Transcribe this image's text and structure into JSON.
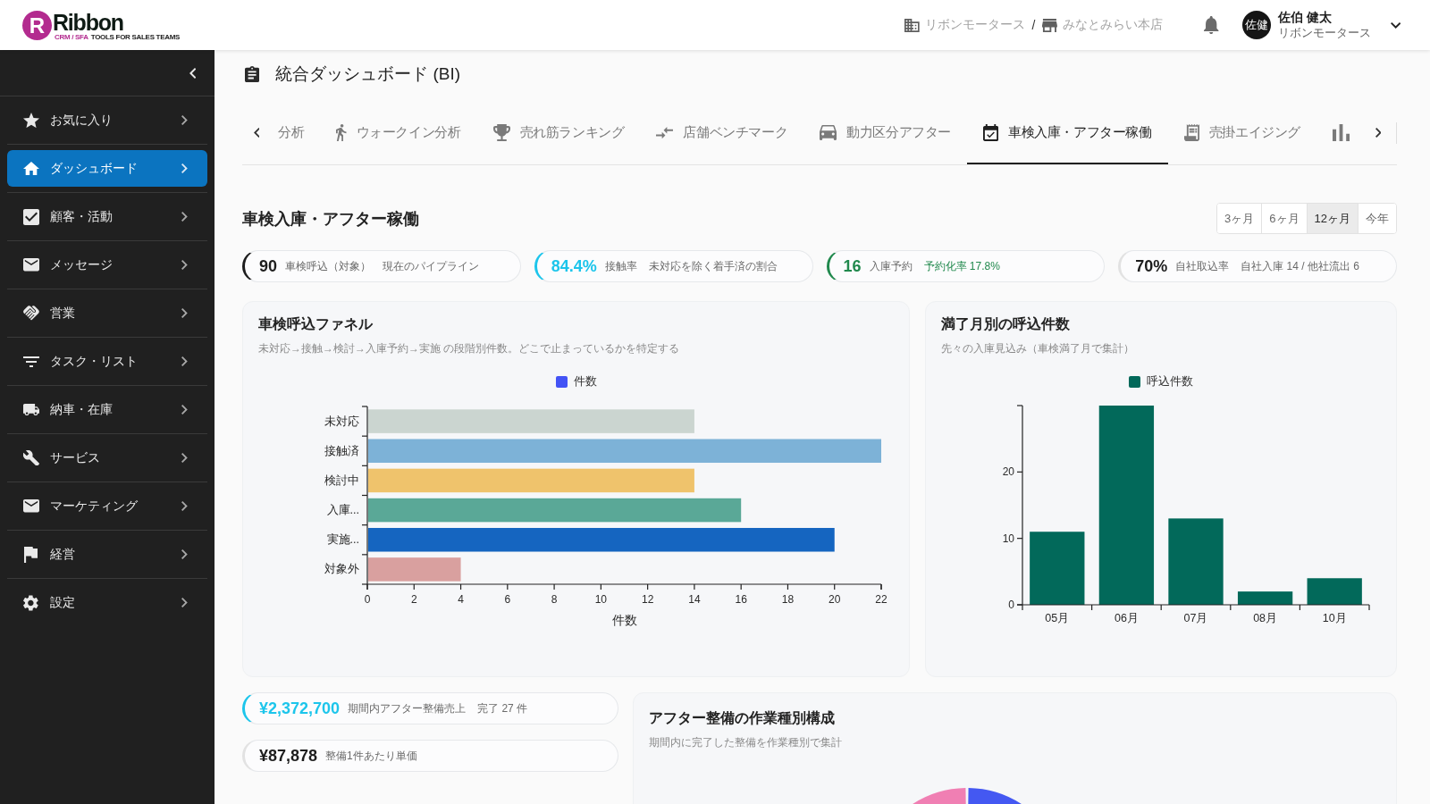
{
  "header": {
    "logo": {
      "mark": "R",
      "name": "Ribbon",
      "tagline_accent": "CRM / SFA",
      "tagline": "TOOLS FOR SALES TEAMS"
    },
    "breadcrumb": [
      {
        "label": "リボンモータース"
      },
      {
        "label": "みなとみらい本店"
      }
    ],
    "breadcrumb_separator": "/",
    "user": {
      "initials": "佐健",
      "name": "佐伯 健太",
      "company": "リボンモータース"
    }
  },
  "sidebar": {
    "items": [
      {
        "label": "お気に入り",
        "selected": false
      },
      {
        "label": "ダッシュボード",
        "selected": true
      },
      {
        "label": "顧客・活動",
        "selected": false
      },
      {
        "label": "メッセージ",
        "selected": false
      },
      {
        "label": "営業",
        "selected": false
      },
      {
        "label": "タスク・リスト",
        "selected": false
      },
      {
        "label": "納車・在庫",
        "selected": false
      },
      {
        "label": "サービス",
        "selected": false
      },
      {
        "label": "マーケティング",
        "selected": false
      },
      {
        "label": "経営",
        "selected": false
      },
      {
        "label": "設定",
        "selected": false
      }
    ]
  },
  "page": {
    "title": "統合ダッシュボード (BI)"
  },
  "tabs": [
    {
      "label": "分析",
      "selected": false
    },
    {
      "label": "ウォークイン分析",
      "selected": false
    },
    {
      "label": "売れ筋ランキング",
      "selected": false
    },
    {
      "label": "店舗ベンチマーク",
      "selected": false
    },
    {
      "label": "動力区分アフター",
      "selected": false
    },
    {
      "label": "車検入庫・アフター稼働",
      "selected": true
    },
    {
      "label": "売掛エイジング",
      "selected": false
    },
    {
      "selected": false
    }
  ],
  "section": {
    "title": "車検入庫・アフター稼働",
    "periods": [
      {
        "label": "3ヶ月",
        "selected": false
      },
      {
        "label": "6ヶ月",
        "selected": false
      },
      {
        "label": "12ヶ月",
        "selected": true
      },
      {
        "label": "今年",
        "selected": false
      }
    ]
  },
  "kpis": [
    {
      "color": "#1d1d1d",
      "value": "90",
      "label": "車検呼込（対象）",
      "note": "現在のパイプライン",
      "note_highlight": false
    },
    {
      "color": "#1cc5eb",
      "value": "84.4%",
      "label": "接触率",
      "note": "未対応を除く着手済の割合",
      "note_highlight": false
    },
    {
      "color": "#21894d",
      "value": "16",
      "label": "入庫予約",
      "note": "予約化率 17.8%",
      "note_highlight": true
    },
    {
      "color": "#e2e2e2",
      "value": "70%",
      "label": "自社取込率",
      "note": "自社入庫 14 / 他社流出 6",
      "note_highlight": false
    }
  ],
  "funnel_card": {
    "title": "車検呼込ファネル",
    "subtitle": "未対応→接触→検討→入庫予約→実施 の段階別件数。どこで止まっているかを特定する",
    "chart_data": {
      "type": "bar",
      "orientation": "horizontal",
      "categories": [
        "未対応",
        "接触済",
        "検討中",
        "入庫...",
        "実施...",
        "対象外"
      ],
      "series": [
        {
          "name": "件数",
          "color": "#4353f5",
          "values": [
            14,
            22,
            14,
            16,
            20,
            4
          ],
          "colors": [
            "#cbd5d0",
            "#7db2d7",
            "#efc36c",
            "#5aa897",
            "#1565c0",
            "#d9a09f"
          ]
        }
      ],
      "xlabel": "件数",
      "xlim": [
        0,
        22
      ],
      "xticks": [
        0,
        2,
        4,
        6,
        8,
        10,
        12,
        14,
        16,
        18,
        20,
        22
      ]
    }
  },
  "expiry_card": {
    "title": "満了月別の呼込件数",
    "subtitle": "先々の入庫見込み（車検満了月で集計）",
    "chart_data": {
      "type": "bar",
      "orientation": "vertical",
      "categories": [
        "05月",
        "06月",
        "07月",
        "08月",
        "10月"
      ],
      "series": [
        {
          "name": "呼込件数",
          "color": "#02695a",
          "values": [
            11,
            30,
            13,
            2,
            4
          ]
        }
      ],
      "ylim": [
        0,
        30
      ],
      "yticks": [
        0,
        10,
        20
      ]
    }
  },
  "after_sales": {
    "kpis": [
      {
        "color": "#1cc5eb",
        "value": "¥2,372,700",
        "label": "期間内アフター整備売上",
        "note": "完了 27 件",
        "note_highlight": false
      },
      {
        "color": "#e2e2e2",
        "value": "¥87,878",
        "label": "整備1件あたり単価"
      }
    ],
    "mix_card": {
      "title": "アフター整備の作業種別構成",
      "subtitle": "期間内に完了した整備を作業種別で集計"
    }
  }
}
